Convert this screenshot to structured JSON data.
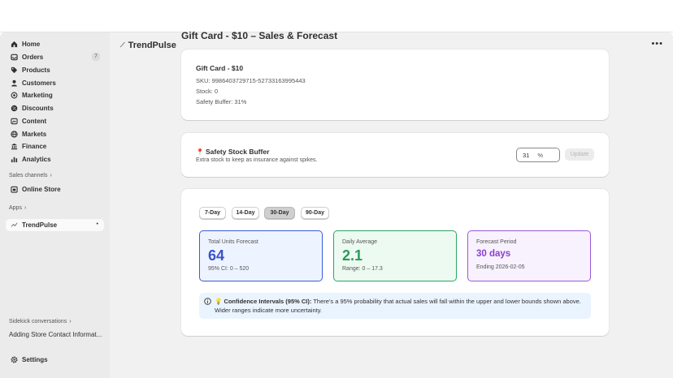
{
  "sidebar": {
    "items": [
      {
        "label": "Home",
        "icon": "home-icon"
      },
      {
        "label": "Orders",
        "icon": "inbox-icon",
        "badge": "7"
      },
      {
        "label": "Products",
        "icon": "tag-icon"
      },
      {
        "label": "Customers",
        "icon": "person-icon"
      },
      {
        "label": "Marketing",
        "icon": "target-icon"
      },
      {
        "label": "Discounts",
        "icon": "discount-icon"
      },
      {
        "label": "Content",
        "icon": "content-icon"
      },
      {
        "label": "Markets",
        "icon": "globe-icon"
      },
      {
        "label": "Finance",
        "icon": "bank-icon"
      },
      {
        "label": "Analytics",
        "icon": "bar-chart-icon"
      }
    ],
    "sales_channels_label": "Sales channels",
    "online_store_label": "Online Store",
    "apps_label": "Apps",
    "app_item_label": "TrendPulse",
    "sidekick_label": "Sidekick conversations",
    "sidekick_item": "Adding Store Contact Informat...",
    "settings_label": "Settings"
  },
  "header": {
    "app_name": "TrendPulse",
    "more": "•••"
  },
  "page": {
    "title": "Gift Card - $10 – Sales & Forecast"
  },
  "product": {
    "name": "Gift Card - $10",
    "sku": "SKU: 9986403729715-52733163995443",
    "stock": "Stock: 0",
    "safety_buffer": "Safety Buffer: 31%"
  },
  "buffer": {
    "title": "Safety Stock Buffer",
    "subtitle": "Extra stock to keep as insurance against spikes.",
    "value": "31",
    "unit": "%",
    "update_label": "Update"
  },
  "forecast": {
    "tabs": [
      "7-Day",
      "14-Day",
      "30-Day",
      "90-Day"
    ],
    "selected_tab": "30-Day",
    "total": {
      "label": "Total Units Forecast",
      "value": "64",
      "sub": "95% CI: 0 – 520"
    },
    "daily": {
      "label": "Daily Average",
      "value": "2.1",
      "sub": "Range: 0 – 17.3"
    },
    "period": {
      "label": "Forecast Period",
      "value": "30 days",
      "sub": "Ending 2026-02-05"
    },
    "info_title": "Confidence Intervals (95% CI):",
    "info_text": " There's a 95% probability that actual sales will fall within the upper and lower bounds shown above. Wider ranges indicate more uncertainty."
  },
  "colors": {
    "blue": "#3b53c8",
    "green": "#2b9a5a",
    "purple": "#8a3fd0"
  }
}
